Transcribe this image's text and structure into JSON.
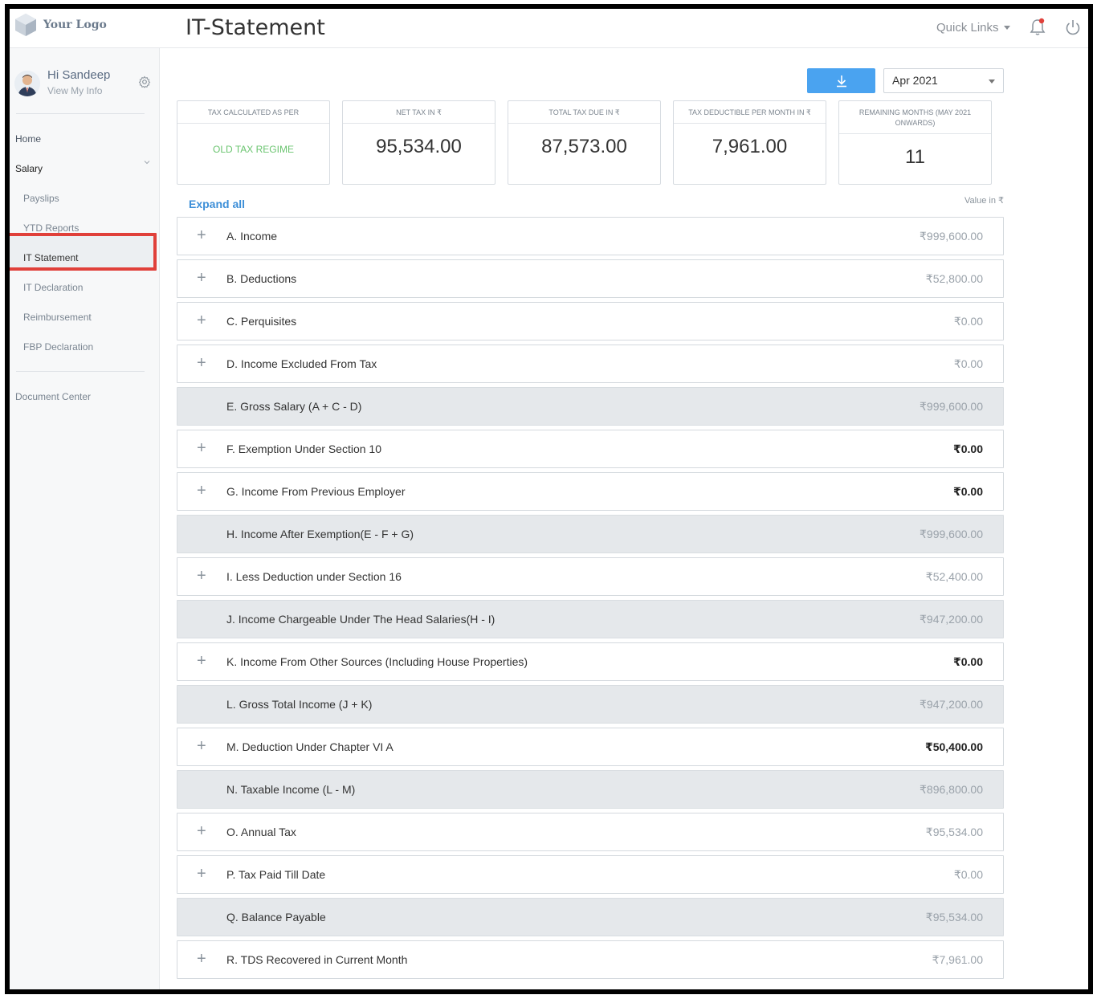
{
  "app": {
    "logo_text": "Your Logo",
    "page_title": "IT-Statement",
    "quick_links": "Quick Links"
  },
  "sidebar": {
    "greeting": "Hi Sandeep",
    "view_info": "View My Info",
    "nav": {
      "home": "Home",
      "salary": "Salary",
      "payslips": "Payslips",
      "ytd_reports": "YTD Reports",
      "it_statement": "IT Statement",
      "it_declaration": "IT Declaration",
      "reimbursement": "Reimbursement",
      "fbp_declaration": "FBP Declaration",
      "document_center": "Document Center"
    }
  },
  "toolbar": {
    "month": "Apr 2021"
  },
  "cards": [
    {
      "title": "TAX CALCULATED AS PER",
      "value": "OLD TAX REGIME"
    },
    {
      "title": "NET TAX IN ₹",
      "value": "95,534.00"
    },
    {
      "title": "TOTAL TAX DUE IN ₹",
      "value": "87,573.00"
    },
    {
      "title": "TAX DEDUCTIBLE PER MONTH IN ₹",
      "value": "7,961.00"
    },
    {
      "title": "REMAINING MONTHS (MAY 2021 ONWARDS)",
      "value": "11"
    }
  ],
  "expand_all": "Expand all",
  "value_in": "Value in ₹",
  "rows": [
    {
      "label": "A. Income",
      "amount": "₹999,600.00",
      "expandable": true,
      "total": false,
      "bold": false
    },
    {
      "label": "B. Deductions",
      "amount": "₹52,800.00",
      "expandable": true,
      "total": false,
      "bold": false
    },
    {
      "label": "C. Perquisites",
      "amount": "₹0.00",
      "expandable": true,
      "total": false,
      "bold": false
    },
    {
      "label": "D. Income Excluded From Tax",
      "amount": "₹0.00",
      "expandable": true,
      "total": false,
      "bold": false
    },
    {
      "label": "E. Gross Salary (A + C - D)",
      "amount": "₹999,600.00",
      "expandable": false,
      "total": true,
      "bold": false
    },
    {
      "label": "F. Exemption Under Section 10",
      "amount": "₹0.00",
      "expandable": true,
      "total": false,
      "bold": true
    },
    {
      "label": "G. Income From Previous Employer",
      "amount": "₹0.00",
      "expandable": true,
      "total": false,
      "bold": true
    },
    {
      "label": "H. Income After Exemption(E - F + G)",
      "amount": "₹999,600.00",
      "expandable": false,
      "total": true,
      "bold": false
    },
    {
      "label": "I. Less Deduction under Section 16",
      "amount": "₹52,400.00",
      "expandable": true,
      "total": false,
      "bold": false
    },
    {
      "label": "J. Income Chargeable Under The Head Salaries(H - I)",
      "amount": "₹947,200.00",
      "expandable": false,
      "total": true,
      "bold": false
    },
    {
      "label": "K. Income From Other Sources (Including House Properties)",
      "amount": "₹0.00",
      "expandable": true,
      "total": false,
      "bold": true
    },
    {
      "label": "L. Gross Total Income (J + K)",
      "amount": "₹947,200.00",
      "expandable": false,
      "total": true,
      "bold": false
    },
    {
      "label": "M. Deduction Under Chapter VI A",
      "amount": "₹50,400.00",
      "expandable": true,
      "total": false,
      "bold": true
    },
    {
      "label": "N. Taxable Income (L - M)",
      "amount": "₹896,800.00",
      "expandable": false,
      "total": true,
      "bold": false
    },
    {
      "label": "O. Annual Tax",
      "amount": "₹95,534.00",
      "expandable": true,
      "total": false,
      "bold": false
    },
    {
      "label": "P. Tax Paid Till Date",
      "amount": "₹0.00",
      "expandable": true,
      "total": false,
      "bold": false
    },
    {
      "label": "Q. Balance Payable",
      "amount": "₹95,534.00",
      "expandable": false,
      "total": true,
      "bold": false
    },
    {
      "label": "R. TDS Recovered in Current Month",
      "amount": "₹7,961.00",
      "expandable": true,
      "total": false,
      "bold": false
    }
  ],
  "colors": {
    "accent": "#4aa3f0",
    "regime_green": "#6ac46f",
    "link_blue": "#3d8fd8",
    "highlight_red": "#e0403a",
    "total_row_bg": "#e5e8eb"
  }
}
